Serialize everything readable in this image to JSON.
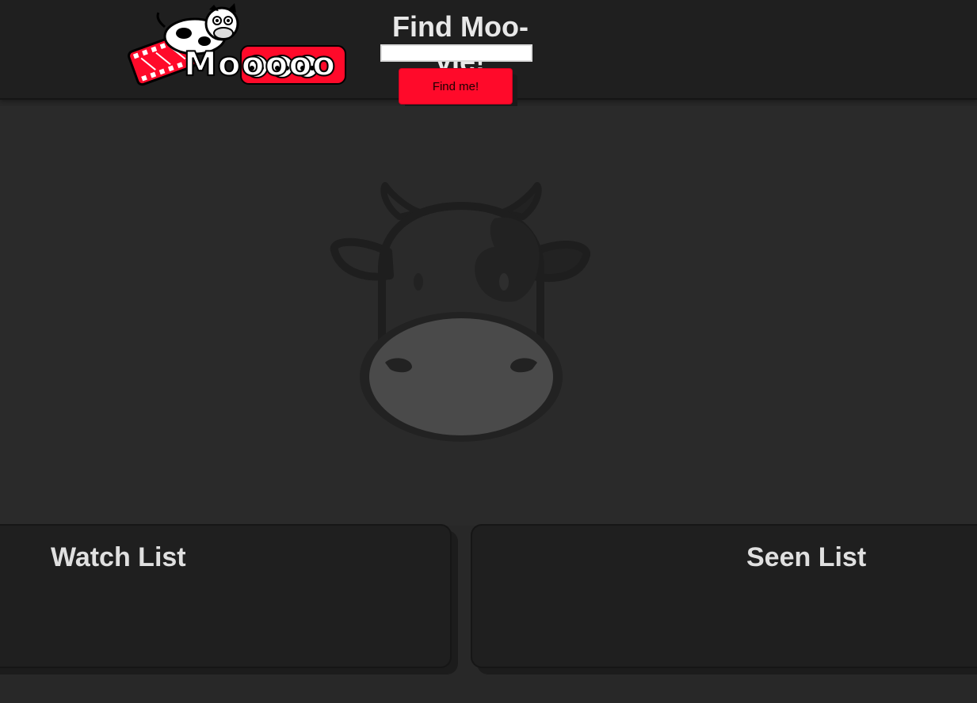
{
  "header": {
    "logo_text": "Mooooo",
    "logo_icon": "cow-on-film-reel-logo",
    "search_title": "Find Moo-vie!",
    "search_value": "",
    "search_placeholder": "",
    "find_button_label": "Find me!"
  },
  "hero": {
    "icon": "cow-face-icon"
  },
  "lists": {
    "watch_title": "Watch List",
    "seen_title": "Seen List"
  },
  "colors": {
    "background": "#282828",
    "header": "#1f1f1f",
    "accent": "#ff0a2a",
    "panel": "#1f1f1f",
    "text": "#e0e0e0"
  }
}
